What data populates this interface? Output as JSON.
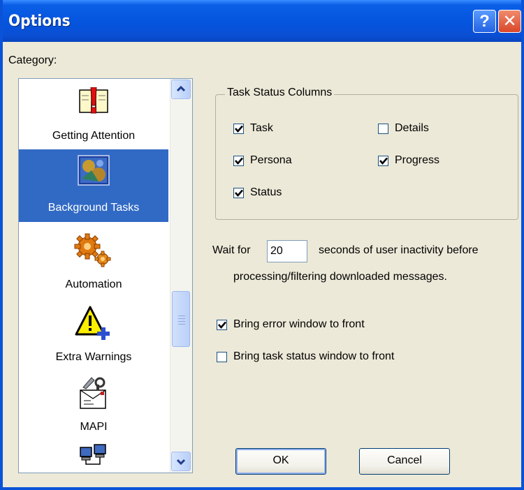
{
  "window": {
    "title": "Options",
    "help_glyph": "?",
    "close_glyph": "✕"
  },
  "category": {
    "label": "Category:",
    "items": [
      {
        "label": "Getting Attention",
        "icon": "getting-attention-icon",
        "selected": false
      },
      {
        "label": "Background Tasks",
        "icon": "background-tasks-icon",
        "selected": true
      },
      {
        "label": "Automation",
        "icon": "automation-gears-icon",
        "selected": false
      },
      {
        "label": "Extra Warnings",
        "icon": "extra-warnings-icon",
        "selected": false
      },
      {
        "label": "MAPI",
        "icon": "mapi-icon",
        "selected": false
      },
      {
        "label": "",
        "icon": "network-computers-icon",
        "selected": false
      }
    ]
  },
  "task_status": {
    "legend": "Task Status Columns",
    "columns": [
      {
        "label": "Task",
        "checked": true
      },
      {
        "label": "Details",
        "checked": false
      },
      {
        "label": "Persona",
        "checked": true
      },
      {
        "label": "Progress",
        "checked": true
      },
      {
        "label": "Status",
        "checked": true
      }
    ]
  },
  "wait": {
    "prefix": "Wait for",
    "value": "20",
    "suffix": "seconds of user inactivity before",
    "line2": "processing/filtering downloaded messages."
  },
  "options": [
    {
      "label": "Bring error window to front",
      "checked": true
    },
    {
      "label": "Bring task status window to front",
      "checked": false
    }
  ],
  "buttons": {
    "ok": "OK",
    "cancel": "Cancel"
  },
  "colors": {
    "title_bar": "#0554de",
    "selection": "#316ac5",
    "dialog_bg": "#ece9d8"
  }
}
